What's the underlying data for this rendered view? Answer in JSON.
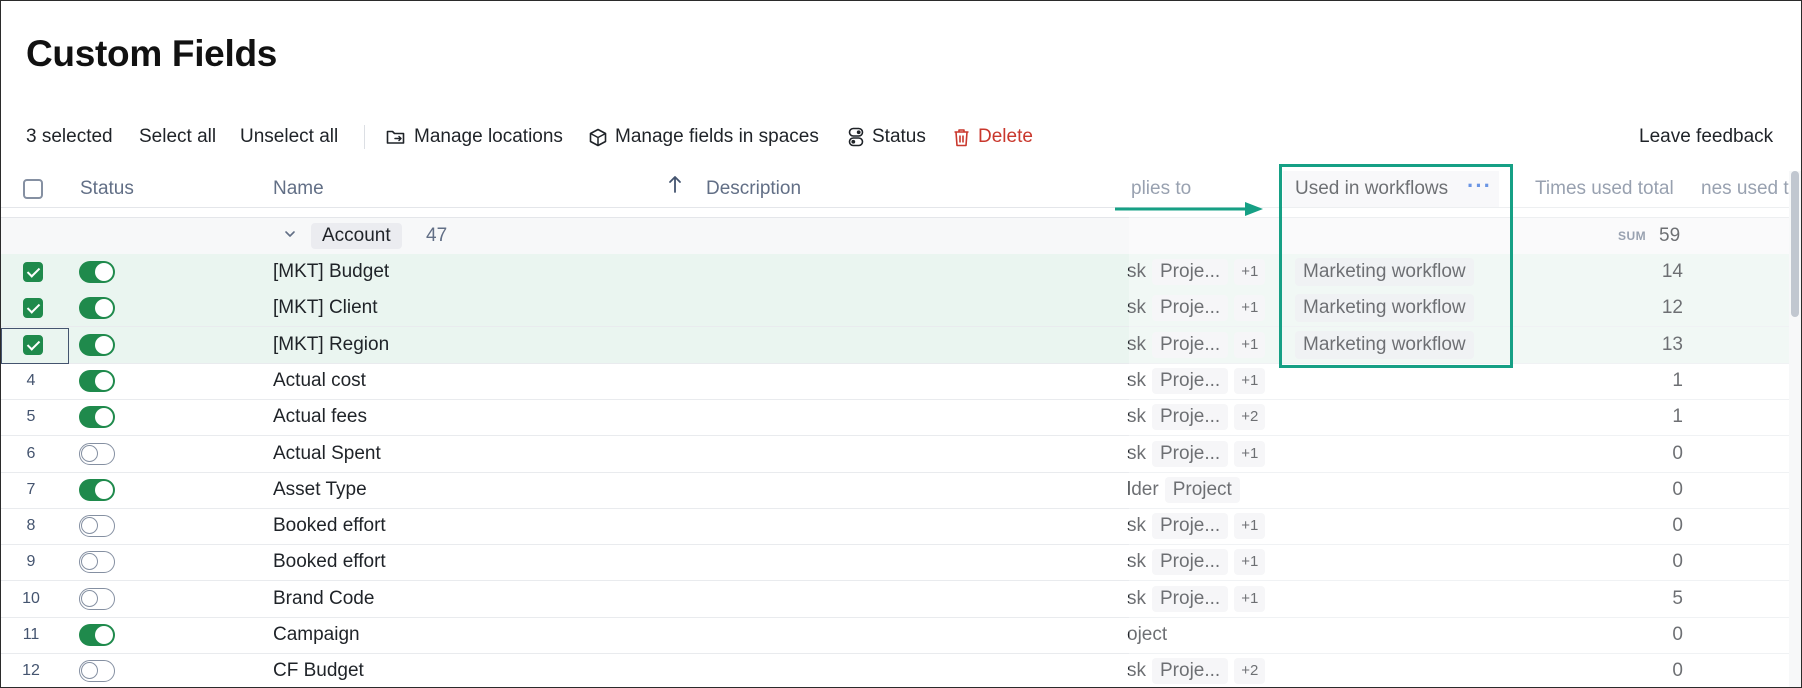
{
  "page": {
    "title": "Custom Fields"
  },
  "toolbar": {
    "selected_count": "3 selected",
    "select_all": "Select all",
    "unselect_all": "Unselect all",
    "manage_locations": "Manage locations",
    "manage_fields": "Manage fields in spaces",
    "status": "Status",
    "delete": "Delete",
    "feedback": "Leave feedback"
  },
  "table": {
    "headers": {
      "status": "Status",
      "name": "Name",
      "description": "Description",
      "applies_to": "plies to",
      "used_in_workflows": "Used in workflows",
      "times_used_total": "Times used total",
      "times_used_partial": "nes used t"
    },
    "group": {
      "label": "Account",
      "count": "47",
      "sum_label": "SUM",
      "sum_value": "59"
    },
    "rows": [
      {
        "num": "",
        "selected": true,
        "active": true,
        "name": "[MKT] Budget",
        "applies": "sk",
        "chip": "Proje...",
        "more": "+1",
        "workflow": "Marketing workflow",
        "times": "14"
      },
      {
        "num": "",
        "selected": true,
        "active": true,
        "name": "[MKT] Client",
        "applies": "sk",
        "chip": "Proje...",
        "more": "+1",
        "workflow": "Marketing workflow",
        "times": "12"
      },
      {
        "num": "",
        "selected": true,
        "active": true,
        "name": "[MKT] Region",
        "applies": "sk",
        "chip": "Proje...",
        "more": "+1",
        "workflow": "Marketing workflow",
        "times": "13"
      },
      {
        "num": "4",
        "selected": false,
        "active": true,
        "name": "Actual cost",
        "applies": "sk",
        "chip": "Proje...",
        "more": "+1",
        "workflow": "",
        "times": "1"
      },
      {
        "num": "5",
        "selected": false,
        "active": true,
        "name": "Actual fees",
        "applies": "sk",
        "chip": "Proje...",
        "more": "+2",
        "workflow": "",
        "times": "1"
      },
      {
        "num": "6",
        "selected": false,
        "active": false,
        "name": "Actual Spent",
        "applies": "sk",
        "chip": "Proje...",
        "more": "+1",
        "workflow": "",
        "times": "0"
      },
      {
        "num": "7",
        "selected": false,
        "active": true,
        "name": "Asset Type",
        "applies": "lder",
        "chip": "Project",
        "more": "",
        "workflow": "",
        "times": "0"
      },
      {
        "num": "8",
        "selected": false,
        "active": false,
        "name": "Booked effort",
        "applies": "sk",
        "chip": "Proje...",
        "more": "+1",
        "workflow": "",
        "times": "0"
      },
      {
        "num": "9",
        "selected": false,
        "active": false,
        "name": "Booked effort",
        "applies": "sk",
        "chip": "Proje...",
        "more": "+1",
        "workflow": "",
        "times": "0"
      },
      {
        "num": "10",
        "selected": false,
        "active": false,
        "name": "Brand Code",
        "applies": "sk",
        "chip": "Proje...",
        "more": "+1",
        "workflow": "",
        "times": "5"
      },
      {
        "num": "11",
        "selected": false,
        "active": true,
        "name": "Campaign",
        "applies": "oject",
        "chip": "",
        "more": "",
        "workflow": "",
        "times": "0"
      },
      {
        "num": "12",
        "selected": false,
        "active": false,
        "name": "CF Budget",
        "applies": "sk",
        "chip": "Proje...",
        "more": "+2",
        "workflow": "",
        "times": "0"
      }
    ]
  },
  "colors": {
    "accent_green": "#1f8a4c",
    "highlight_teal": "#16a085",
    "delete_red": "#c9372c",
    "selected_row": "#eaf5f0"
  }
}
